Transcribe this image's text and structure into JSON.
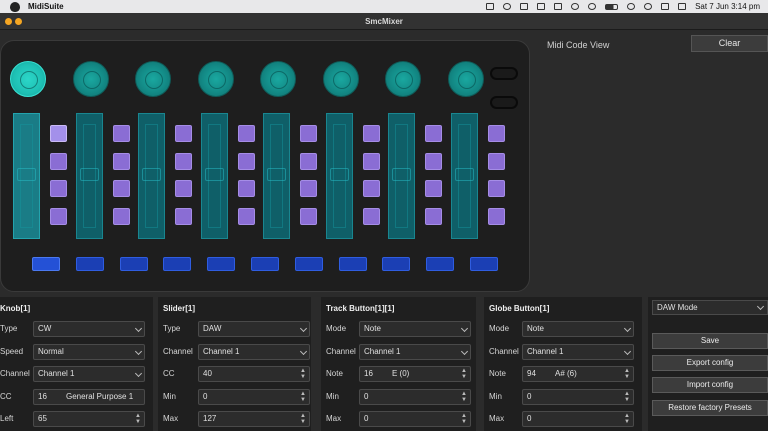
{
  "menubar": {
    "app_name": "MidiSuite",
    "datetime": "Sat 7 Jun  3:14 pm",
    "icons": [
      "apple-icon",
      "cat-icon",
      "note-icon",
      "volume-icon",
      "pencil-icon",
      "window-icon",
      "bluetooth-icon",
      "play-icon",
      "battery-icon",
      "wifi-icon",
      "search-icon",
      "display-icon",
      "control-center-icon"
    ]
  },
  "window": {
    "title": "SmcMixer",
    "traffic_lights": [
      "#f5a623",
      "#f5a623"
    ]
  },
  "device": {
    "knob_count": 8,
    "active_knob": 0,
    "selected_track_button": 0,
    "colors": {
      "knob": "#138a86",
      "slider": "#1a7c86",
      "track_button": "#8a6dd4",
      "globe_button": "#1b3fb4"
    }
  },
  "midi_view": {
    "title": "Midi Code View",
    "clear_label": "Clear"
  },
  "panels": {
    "knob": {
      "header": "Knob[1]",
      "rows": [
        {
          "label": "Type",
          "value": "CW"
        },
        {
          "label": "Speed",
          "value": "Normal"
        },
        {
          "label": "Channel",
          "value": "Channel 1"
        },
        {
          "label": "CC",
          "value": "16",
          "extra": "General Purpose 1"
        },
        {
          "label": "Left",
          "value": "65"
        }
      ]
    },
    "slider": {
      "header": "Slider[1]",
      "rows": [
        {
          "label": "Type",
          "value": "DAW"
        },
        {
          "label": "Channel",
          "value": "Channel 1"
        },
        {
          "label": "CC",
          "value": "40"
        },
        {
          "label": "Min",
          "value": "0"
        },
        {
          "label": "Max",
          "value": "127"
        }
      ]
    },
    "track": {
      "header": "Track Button[1][1]",
      "rows": [
        {
          "label": "Mode",
          "value": "Note"
        },
        {
          "label": "Channel",
          "value": "Channel 1"
        },
        {
          "label": "Note",
          "value": "16",
          "extra": "E (0)"
        },
        {
          "label": "Min",
          "value": "0"
        },
        {
          "label": "Max",
          "value": "0"
        }
      ]
    },
    "globe": {
      "header": "Globe Button[1]",
      "rows": [
        {
          "label": "Mode",
          "value": "Note"
        },
        {
          "label": "Channel",
          "value": "Channel 1"
        },
        {
          "label": "Note",
          "value": "94",
          "extra": "A# (6)"
        },
        {
          "label": "Min",
          "value": "0"
        },
        {
          "label": "Max",
          "value": "0"
        }
      ]
    }
  },
  "actions": {
    "mode_select": "DAW Mode",
    "save": "Save",
    "export": "Export  config",
    "import": "Import config",
    "restore": "Restore factory Presets"
  }
}
